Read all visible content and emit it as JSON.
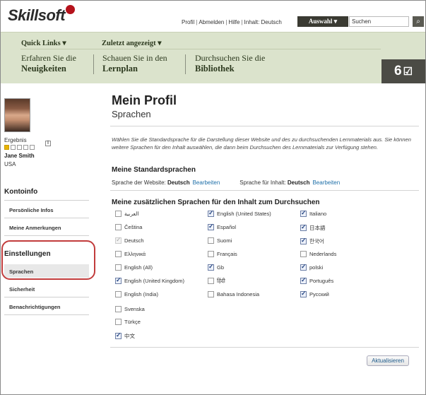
{
  "brand": {
    "logo_text": "Skillsoft"
  },
  "top_links": [
    "Profil",
    "Abmelden",
    "Hilfe",
    "Inhalt: Deutsch"
  ],
  "auswahl_label": "Auswahl ▾",
  "search": {
    "value": "Suchen"
  },
  "nav": {
    "quick_links": "Quick Links ▾",
    "recent": "Zuletzt angezeigt ▾",
    "items": [
      {
        "line1": "Erfahren Sie die",
        "line2": "Neuigkeiten"
      },
      {
        "line1": "Schauen Sie in den",
        "line2": "Lernplan"
      },
      {
        "line1": "Durchsuchen Sie die",
        "line2": "Bibliothek"
      }
    ],
    "counter": "6"
  },
  "user": {
    "score_label": "Ergebnis",
    "stars_filled": 1,
    "stars_total": 5,
    "name": "Jane Smith",
    "country": "USA"
  },
  "sidebar": {
    "account_heading": "Kontoinfo",
    "account_items": [
      "Persönliche Infos",
      "Meine Anmerkungen"
    ],
    "settings_heading": "Einstellungen",
    "settings_items": [
      "Sprachen",
      "Sicherheit",
      "Benachrichtigungen"
    ]
  },
  "main": {
    "title": "Mein Profil",
    "subtitle": "Sprachen",
    "intro": "Wählen Sie die Standardsprache für die Darstellung dieser Website und des zu durchsuchenden Lernmaterials aus. Sie können weitere Sprachen für den Inhalt auswählen, die dann beim Durchsuchen des Lernmaterials zur Verfügung stehen.",
    "std_heading": "Meine Standardsprachen",
    "site_lang_label": "Sprache der Website:",
    "site_lang_value": "Deutsch",
    "content_lang_label": "Sprache für Inhalt:",
    "content_lang_value": "Deutsch",
    "edit_label": "Bearbeiten",
    "extra_heading": "Meine zusätzlichen Sprachen für den Inhalt zum Durchsuchen",
    "languages": {
      "col1": [
        {
          "label": "العربية",
          "state": "off"
        },
        {
          "label": "Čeština",
          "state": "off"
        },
        {
          "label": "Deutsch",
          "state": "disabled"
        },
        {
          "label": "Ελληνικά",
          "state": "off"
        },
        {
          "label": "English (All)",
          "state": "off"
        },
        {
          "label": "English (United Kingdom)",
          "state": "on"
        },
        {
          "label": "English (India)",
          "state": "off"
        },
        {
          "label": "Svenska",
          "state": "off"
        },
        {
          "label": "Türkçe",
          "state": "off"
        },
        {
          "label": "中文",
          "state": "on"
        }
      ],
      "col2": [
        {
          "label": "English (United States)",
          "state": "on"
        },
        {
          "label": "Español",
          "state": "on"
        },
        {
          "label": "Suomi",
          "state": "off"
        },
        {
          "label": "Français",
          "state": "off"
        },
        {
          "label": "Gb",
          "state": "on"
        },
        {
          "label": "हिंदी",
          "state": "off"
        },
        {
          "label": "Bahasa Indonesia",
          "state": "off"
        }
      ],
      "col3": [
        {
          "label": "Italiano",
          "state": "on"
        },
        {
          "label": "日本語",
          "state": "on"
        },
        {
          "label": "한국어",
          "state": "on"
        },
        {
          "label": "Nederlands",
          "state": "off"
        },
        {
          "label": "polski",
          "state": "on"
        },
        {
          "label": "Português",
          "state": "on"
        },
        {
          "label": "Русский",
          "state": "on"
        }
      ]
    },
    "update_label": "Aktualisieren"
  }
}
